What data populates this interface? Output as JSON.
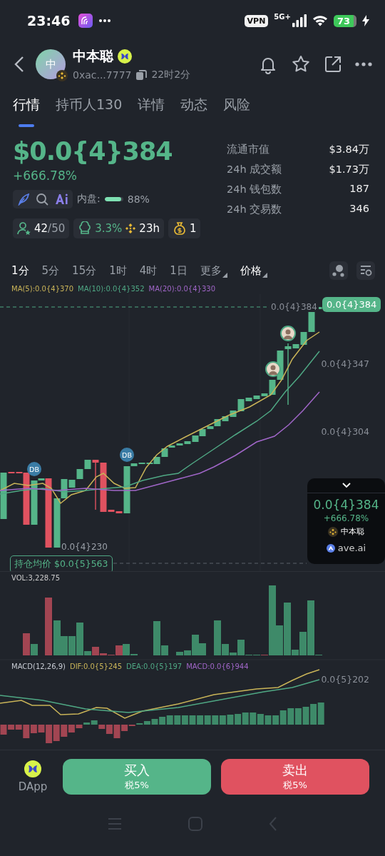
{
  "status_bar": {
    "time": "23:46",
    "vpn": "VPN",
    "network": "5G+",
    "battery": "73"
  },
  "header": {
    "avatar_text": "中",
    "name": "中本聪",
    "address": "0xac...7777",
    "age": "22时2分"
  },
  "tabs": [
    {
      "label": "行情",
      "selected": true
    },
    {
      "label": "持币人130",
      "selected": false
    },
    {
      "label": "详情",
      "selected": false
    },
    {
      "label": "动态",
      "selected": false
    },
    {
      "label": "风险",
      "selected": false
    }
  ],
  "price": {
    "value": "$0.0{4}384",
    "change": "+666.78%"
  },
  "inner_pool": {
    "label": "内盘:",
    "level": 0.88,
    "reading": "88%"
  },
  "stats": [
    {
      "label": "流通市值",
      "value": "$3.84万"
    },
    {
      "label": "24h 成交额",
      "value": "$1.73万"
    },
    {
      "label": "24h 钱包数",
      "value": "187"
    },
    {
      "label": "24h 交易数",
      "value": "346"
    }
  ],
  "chips": {
    "holders": "42",
    "holders_limit": "/50",
    "dev_share": "3.3%",
    "age": "23h",
    "bags": "1"
  },
  "intervals": [
    {
      "label": "1分",
      "selected": true,
      "kind": "option"
    },
    {
      "label": "5分",
      "selected": false,
      "kind": "option"
    },
    {
      "label": "15分",
      "selected": false,
      "kind": "option"
    },
    {
      "label": "1时",
      "selected": false,
      "kind": "option"
    },
    {
      "label": "4时",
      "selected": false,
      "kind": "option"
    },
    {
      "label": "1日",
      "selected": false,
      "kind": "option"
    },
    {
      "label": "更多",
      "selected": false,
      "kind": "dropdown"
    }
  ],
  "chart_type": {
    "label": "价格"
  },
  "ma_legend": [
    {
      "label": "MA(5):0.0{4}370",
      "color": "#c9b458"
    },
    {
      "label": "MA(10):0.0{4}352",
      "color": "#4fa884"
    },
    {
      "label": "MA(20):0.0{4}330",
      "color": "#a066c8"
    }
  ],
  "chart": {
    "price_ticks": [
      "0.0{4}347",
      "0.0{4}304"
    ],
    "last_price_label": "0.0{4}384",
    "last_price_badge": "0.0{4}384",
    "low_label": "0.0{4}230",
    "markers": [
      "DB",
      "DB"
    ],
    "avg_cost": "持仓均价 $0.0{5}563"
  },
  "price_card": {
    "price": "0.0{4}384",
    "change": "+666.78%",
    "token": "中本聪",
    "source": "ave.ai"
  },
  "volume": {
    "label": "VOL:3,228.75"
  },
  "macd": {
    "legend": [
      {
        "label": "MACD(12,26,9)",
        "color": "#c8ccd4"
      },
      {
        "label": "DIF:0.0{5}245",
        "color": "#c9b458"
      },
      {
        "label": "DEA:0.0{5}197",
        "color": "#4fa884"
      },
      {
        "label": "MACD:0.0{6}944",
        "color": "#a066c8"
      }
    ],
    "tick": "0.0{5}202"
  },
  "actions": {
    "dapp": "DApp",
    "buy": {
      "label": "买入",
      "tax": "税5%"
    },
    "sell": {
      "label": "卖出",
      "tax": "税5%"
    }
  }
}
